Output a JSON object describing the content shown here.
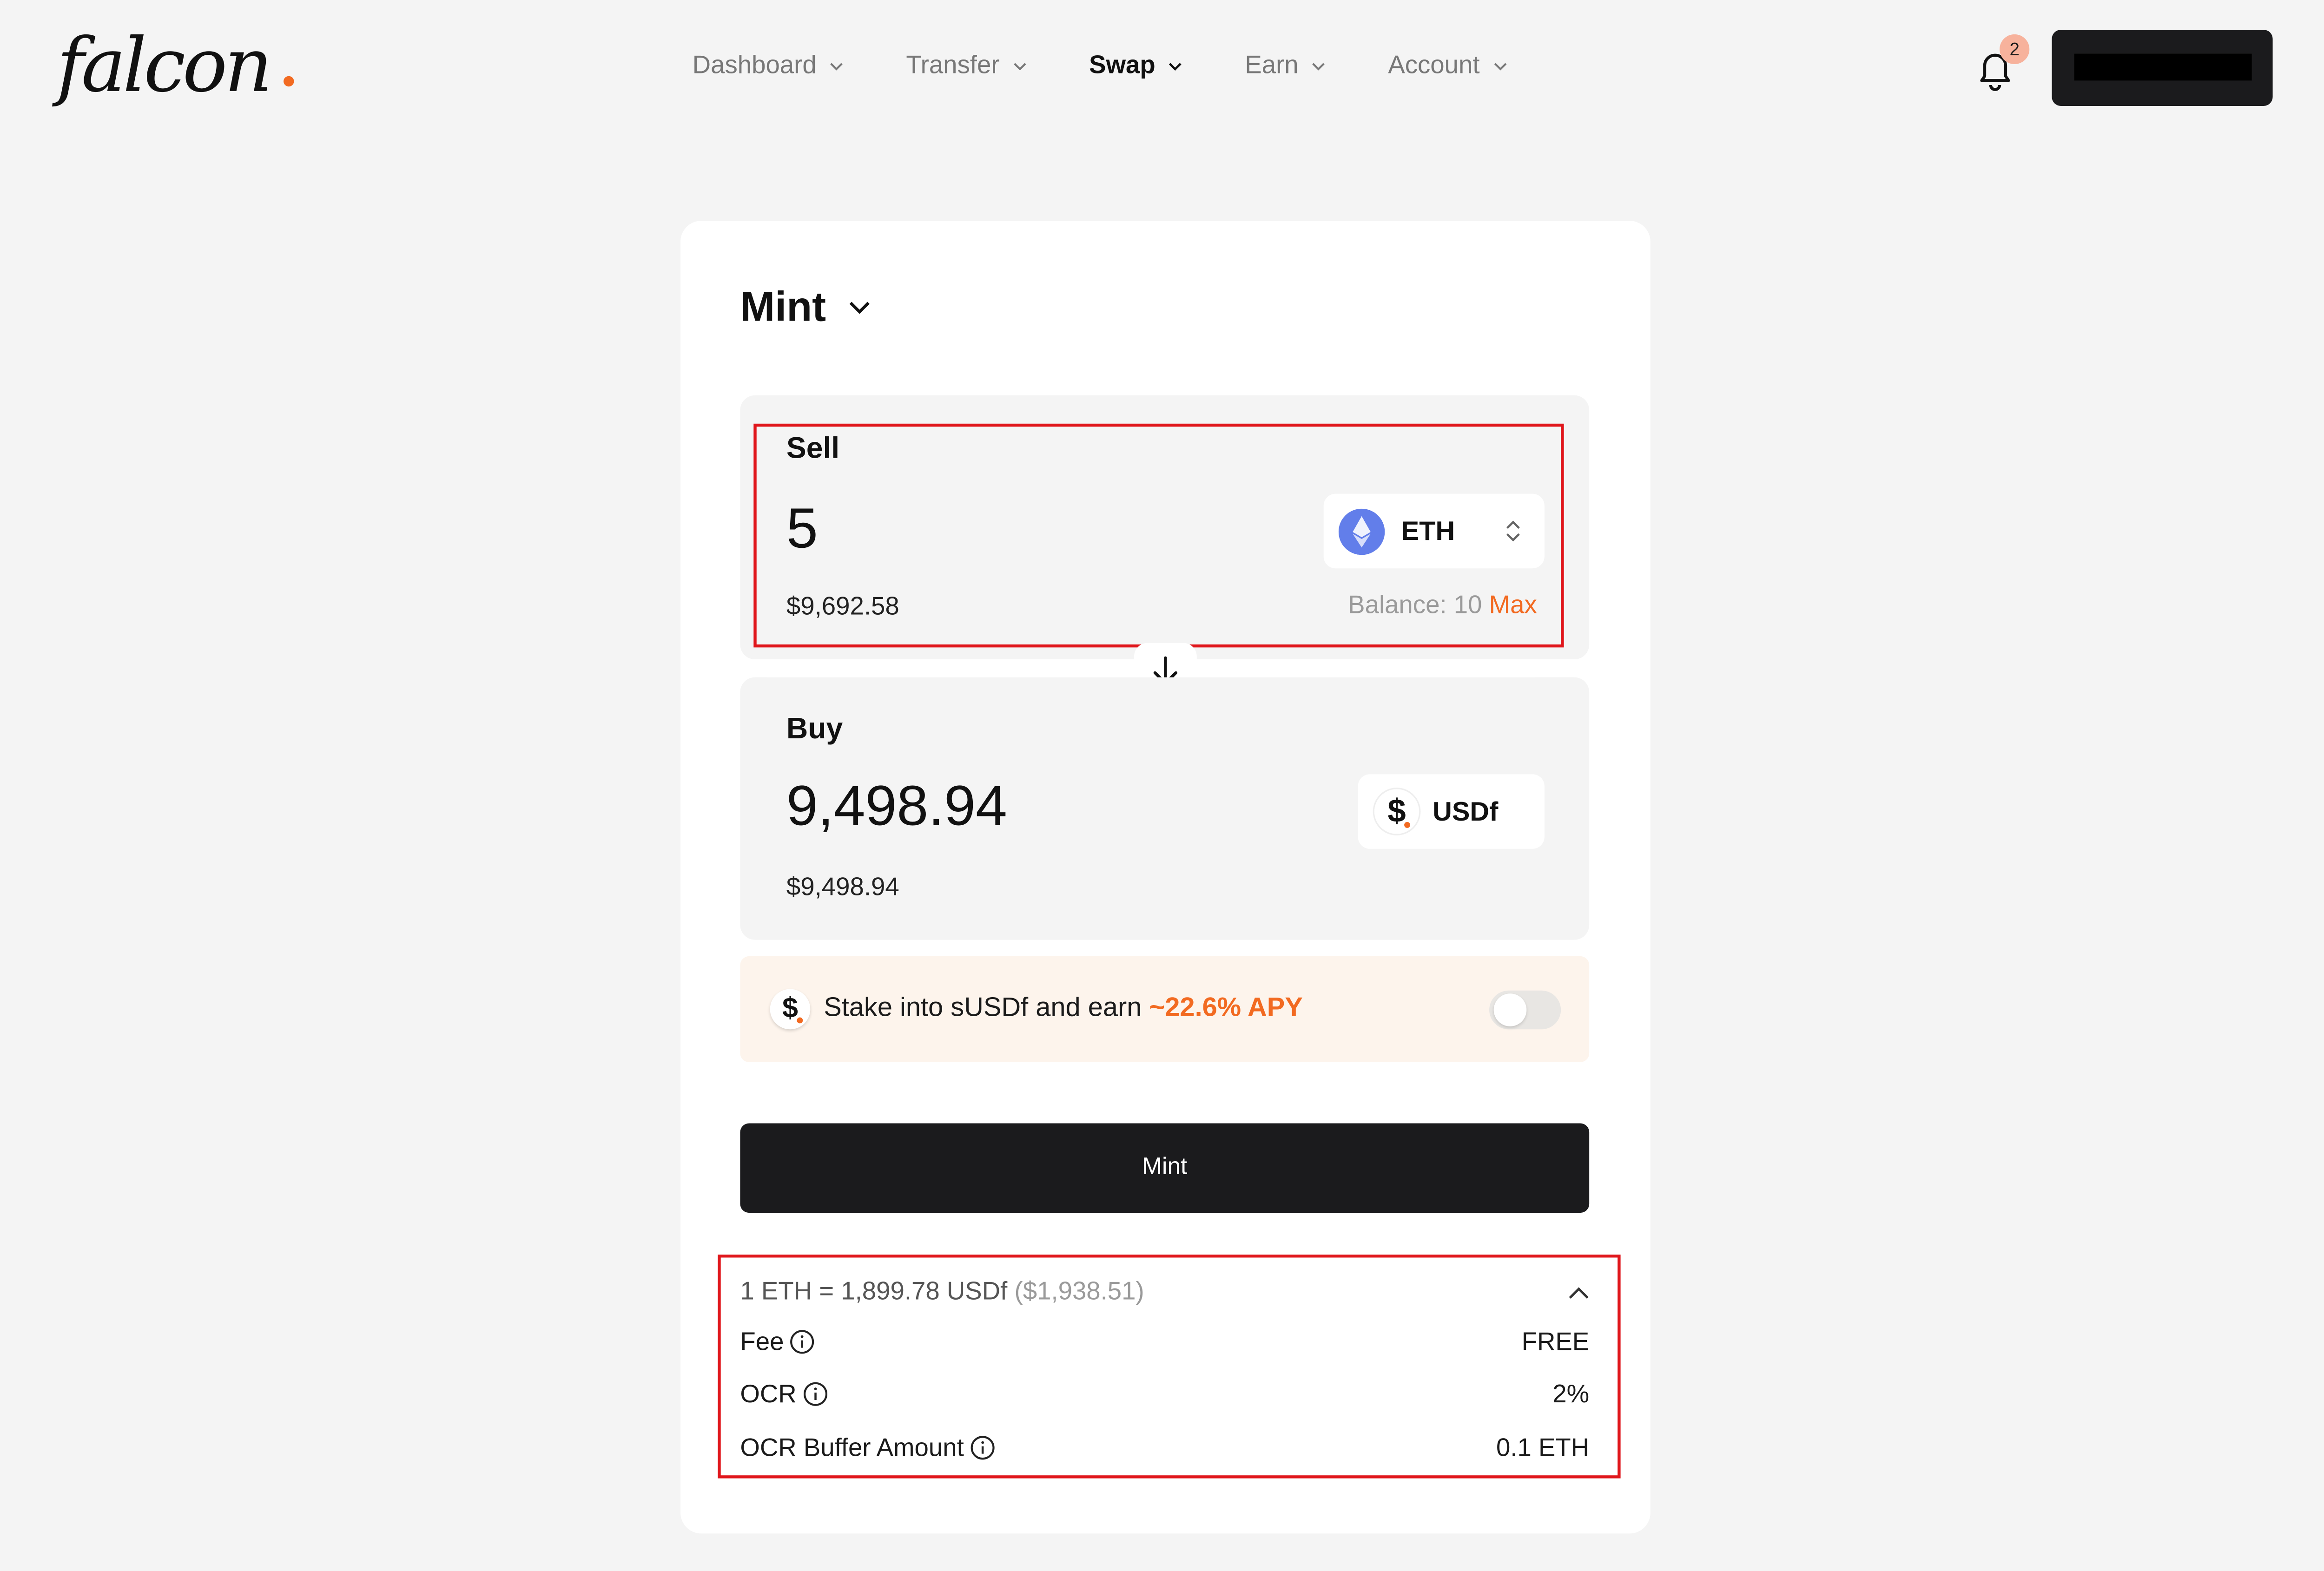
{
  "brand": {
    "logo_text": "falcon",
    "accent_color": "#f26a21"
  },
  "nav": {
    "items": [
      {
        "label": "Dashboard",
        "active": false
      },
      {
        "label": "Transfer",
        "active": false
      },
      {
        "label": "Swap",
        "active": true
      },
      {
        "label": "Earn",
        "active": false
      },
      {
        "label": "Account",
        "active": false
      }
    ]
  },
  "notifications": {
    "count": "2",
    "icon": "bell-icon"
  },
  "wallet": {
    "label": "",
    "redacted": true
  },
  "swap": {
    "mode": "Mint",
    "sell": {
      "label": "Sell",
      "amount": "5",
      "usd_value": "$9,692.58",
      "token": "ETH",
      "balance_label": "Balance: 10",
      "max_label": "Max"
    },
    "buy": {
      "label": "Buy",
      "amount": "9,498.94",
      "usd_value": "$9,498.94",
      "token": "USDf"
    },
    "stake": {
      "text": "Stake into sUSDf and earn",
      "apy": "~22.6% APY",
      "enabled": false
    },
    "submit_label": "Mint",
    "details": {
      "rate": "1 ETH = 1,899.78 USDf",
      "rate_usd": "($1,938.51)",
      "expanded": true,
      "rows": [
        {
          "label": "Fee",
          "value": "FREE"
        },
        {
          "label": "OCR",
          "value": "2%"
        },
        {
          "label": "OCR Buffer Amount",
          "value": "0.1 ETH"
        }
      ]
    }
  }
}
